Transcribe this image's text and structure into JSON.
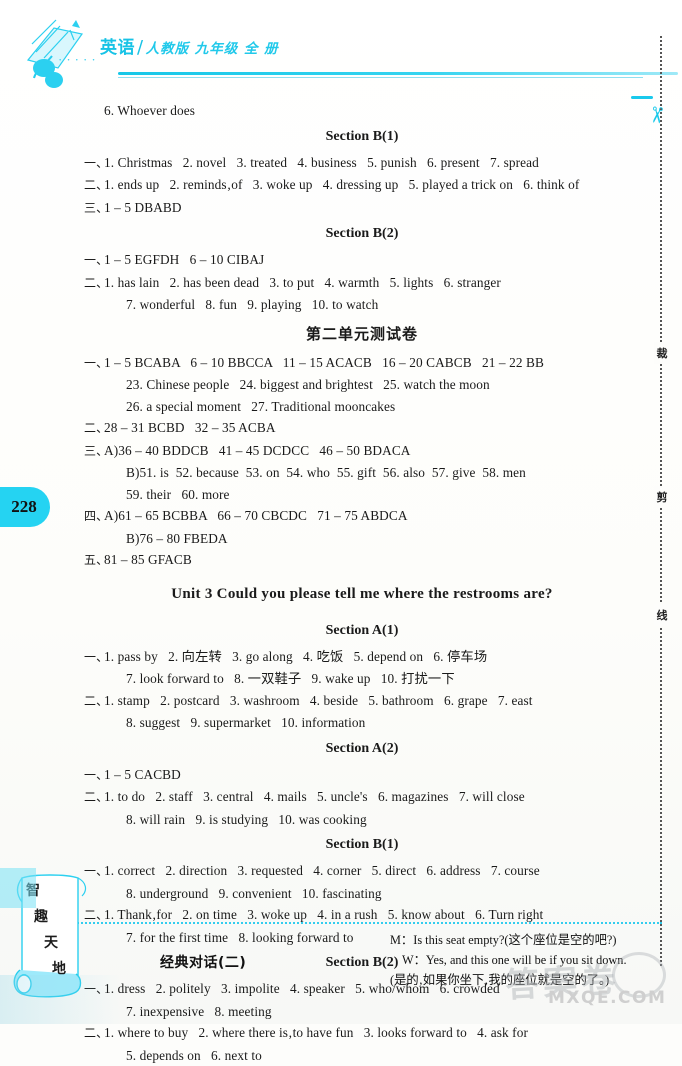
{
  "header": {
    "subject": "英语",
    "slash": "/",
    "edition": "人教版  九年级  全  册",
    "dots": "·····"
  },
  "page_number": "228",
  "cut_line": {
    "scissors_icon": "scissors-icon",
    "chars": [
      "裁",
      "剪",
      "线"
    ]
  },
  "content": [
    {
      "type": "line",
      "marker": "",
      "text": "6. Whoever does"
    },
    {
      "type": "ctr",
      "text": "Section B(1)"
    },
    {
      "type": "line",
      "marker": "一、",
      "text": "1. Christmas   2. novel   3. treated   4. business   5. punish   6. present   7. spread"
    },
    {
      "type": "line",
      "marker": "二、",
      "text": "1. ends up   2. reminds‚of   3. woke up   4. dressing up   5. played a trick on   6. think of"
    },
    {
      "type": "line",
      "marker": "三、",
      "text": "1 – 5 DBABD"
    },
    {
      "type": "ctr",
      "text": "Section B(2)"
    },
    {
      "type": "line",
      "marker": "一、",
      "text": "1 – 5 EGFDH   6 – 10 CIBAJ"
    },
    {
      "type": "line",
      "marker": "二、",
      "text": "1. has lain   2. has been dead   3. to put   4. warmth   5. lights   6. stranger"
    },
    {
      "type": "line",
      "marker": "",
      "indent": true,
      "text": "7. wonderful   8. fun   9. playing   10. to watch"
    },
    {
      "type": "ctr_cn",
      "text": "第二单元测试卷"
    },
    {
      "type": "line",
      "marker": "一、",
      "text": "1 – 5 BCABA   6 – 10 BBCCA   11 – 15 ACACB   16 – 20 CABCB   21 – 22 BB"
    },
    {
      "type": "line",
      "marker": "",
      "indent": true,
      "text": "23. Chinese people   24. biggest and brightest   25. watch the moon"
    },
    {
      "type": "line",
      "marker": "",
      "indent": true,
      "text": "26. a special moment   27. Traditional mooncakes"
    },
    {
      "type": "line",
      "marker": "二、",
      "text": "28 – 31 BCBD   32 – 35 ACBA"
    },
    {
      "type": "line",
      "marker": "三、",
      "text": "A)36 – 40 BDDCB   41 – 45 DCDCC   46 – 50 BDACA"
    },
    {
      "type": "line",
      "marker": "",
      "indent": true,
      "text": "B)51. is  52. because  53. on  54. who  55. gift  56. also  57. give  58. men"
    },
    {
      "type": "line",
      "marker": "",
      "indent": true,
      "text": "59. their   60. more"
    },
    {
      "type": "line",
      "marker": "四、",
      "text": "A)61 – 65 BCBBA   66 – 70 CBCDC   71 – 75 ABDCA"
    },
    {
      "type": "line",
      "marker": "",
      "indent": true,
      "text": "B)76 – 80 FBEDA"
    },
    {
      "type": "line",
      "marker": "五、",
      "text": "81 – 85 GFACB"
    },
    {
      "type": "ctr_unit",
      "text": "Unit 3   Could you please tell me where the restrooms are?"
    },
    {
      "type": "ctr",
      "text": "Section A(1)"
    },
    {
      "type": "line",
      "marker": "一、",
      "text": "1. pass by   2. 向左转   3. go along   4. 吃饭   5. depend on   6. 停车场"
    },
    {
      "type": "line",
      "marker": "",
      "indent": true,
      "text": "7. look forward to   8. 一双鞋子   9. wake up   10. 打扰一下"
    },
    {
      "type": "line",
      "marker": "二、",
      "text": "1. stamp   2. postcard   3. washroom   4. beside   5. bathroom   6. grape   7. east"
    },
    {
      "type": "line",
      "marker": "",
      "indent": true,
      "text": "8. suggest   9. supermarket   10. information"
    },
    {
      "type": "ctr",
      "text": "Section A(2)"
    },
    {
      "type": "line",
      "marker": "一、",
      "text": "1 – 5 CACBD"
    },
    {
      "type": "line",
      "marker": "二、",
      "text": "1. to do   2. staff   3. central   4. mails   5. uncle's   6. magazines   7. will close"
    },
    {
      "type": "line",
      "marker": "",
      "indent": true,
      "text": "8. will rain   9. is studying   10. was cooking"
    },
    {
      "type": "ctr",
      "text": "Section B(1)"
    },
    {
      "type": "line",
      "marker": "一、",
      "text": "1. correct   2. direction   3. requested   4. corner   5. direct   6. address   7. course"
    },
    {
      "type": "line",
      "marker": "",
      "indent": true,
      "text": "8. underground   9. convenient   10. fascinating"
    },
    {
      "type": "line",
      "marker": "二、",
      "text": "1. Thank‚for   2. on time   3. woke up   4. in a rush   5. know about   6. Turn right"
    },
    {
      "type": "line",
      "marker": "",
      "indent": true,
      "text": "7. for the first time   8. looking forward to"
    },
    {
      "type": "ctr",
      "text": "Section B(2)"
    },
    {
      "type": "line",
      "marker": "一、",
      "text": "1. dress   2. politely   3. impolite   4. speaker   5. who/whom   6. crowded"
    },
    {
      "type": "line",
      "marker": "",
      "indent": true,
      "text": "7. inexpensive   8. meeting"
    },
    {
      "type": "line",
      "marker": "二、",
      "text": "1. where to buy   2. where there is‚to have fun   3. looks forward to   4. ask for"
    },
    {
      "type": "line",
      "marker": "",
      "indent": true,
      "text": "5. depends on   6. next to"
    }
  ],
  "footer": {
    "scroll_text": [
      "智",
      "趣",
      "天",
      "地"
    ],
    "label": "经典对话(二)",
    "dialog": [
      "M：Is this seat empty?(这个座位是空的吧?)",
      "W：Yes, and this one will be if you sit down.",
      "(是的‚如果你坐下‚我的座位就是空的了。)"
    ]
  },
  "watermarks": {
    "site": "MXQE.COM",
    "chinese": "答案卷"
  },
  "colors": {
    "accent": "#25d3f2",
    "rule": "#16c7e8",
    "text": "#1a1a1a"
  }
}
